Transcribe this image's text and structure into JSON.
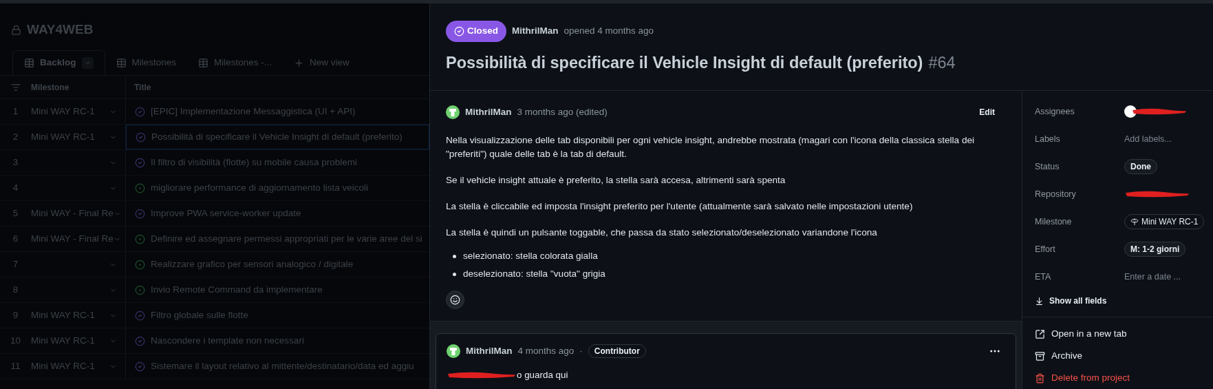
{
  "project": {
    "title": "WAY4WEB"
  },
  "views": [
    {
      "label": "Backlog",
      "selected": true
    },
    {
      "label": "Milestones",
      "selected": false
    },
    {
      "label": "Milestones -...",
      "selected": false
    }
  ],
  "new_view": "New view",
  "table": {
    "columns": [
      "Milestone",
      "Title"
    ],
    "rows": [
      {
        "number": "1",
        "milestone": "Mini WAY RC-1",
        "kind": "closed",
        "title": "[EPIC] Implementazione Messaggistica (UI + API)",
        "selected": false
      },
      {
        "number": "2",
        "milestone": "Mini WAY RC-1",
        "kind": "closed",
        "title": "Possibilità di specificare il Vehicle Insight di default (preferito)",
        "selected": true
      },
      {
        "number": "3",
        "kind": "closed",
        "title": "Il filtro di visibilità (flotte) su mobile causa problemi",
        "selected": false
      },
      {
        "number": "4",
        "kind": "open",
        "title": "migliorare performance di aggiornamento lista veicoli",
        "selected": false
      },
      {
        "number": "5",
        "milestone": "Mini WAY - Final Re",
        "kind": "closed",
        "title": "Improve PWA service-worker update",
        "selected": false
      },
      {
        "number": "6",
        "milestone": "Mini WAY - Final Re",
        "kind": "open",
        "title": "Definire ed assegnare permessi appropriati per le varie aree del si",
        "selected": false
      },
      {
        "number": "7",
        "kind": "open",
        "title": "Realizzare grafico per sensori analogico / digitale",
        "selected": false
      },
      {
        "number": "8",
        "kind": "open",
        "title": "Invio Remote Command da implementare",
        "selected": false
      },
      {
        "number": "9",
        "milestone": "Mini WAY RC-1",
        "kind": "closed",
        "title": "Filtro globale sulle flotte",
        "selected": false
      },
      {
        "number": "10",
        "milestone": "Mini WAY RC-1",
        "kind": "closed",
        "title": "Nascondere i template non necessari",
        "selected": false
      },
      {
        "number": "11",
        "milestone": "Mini WAY RC-1",
        "kind": "closed",
        "title": "Sistemare il layout relativo al mittente/destinatario/data ed aggiu",
        "selected": false
      }
    ]
  },
  "issue": {
    "status": "Closed",
    "author": "MithrilMan",
    "opened": "opened 4 months ago",
    "title": "Possibilità di specificare il Vehicle Insight di default (preferito)",
    "number": "#64"
  },
  "comments": [
    {
      "author": "MithrilMan",
      "time": "3 months ago (edited)",
      "action": "Edit",
      "paragraphs": [
        "Nella visualizzazione delle tab disponibili per ogni vehicle insight, andrebbe mostrata (magari con l'icona della classica stella dei \"preferiti\") quale delle tab è la tab di default.",
        "Se il vehicle insight attuale è preferito, la stella sarà accesa, altrimenti sarà spenta",
        "La stella è cliccabile ed imposta l'insight preferito per l'utente (attualmente sarà salvato nelle impostazioni utente)",
        "La stella è quindi un pulsante toggable, che passa da stato selezionato/deselezionato variandone l'icona"
      ],
      "bullets": [
        "selezionato: stella colorata gialla",
        "deselezionato: stella \"vuota\" grigia"
      ]
    },
    {
      "author": "MithrilMan",
      "time": "4 months ago",
      "separator": "·",
      "role": "Contributor",
      "body": "o guarda qui"
    }
  ],
  "sidebar": {
    "fields": [
      {
        "kind": "avatar",
        "label": "Assignees"
      },
      {
        "kind": "placeholder",
        "label": "Labels",
        "value": "Add labels..."
      },
      {
        "kind": "pill",
        "label": "Status",
        "value": "Done"
      },
      {
        "kind": "redacted",
        "label": "Repository"
      },
      {
        "kind": "milestone",
        "label": "Milestone",
        "value": "Mini WAY RC-1"
      },
      {
        "kind": "pill",
        "label": "Effort",
        "value": "M: 1-2 giorni"
      },
      {
        "kind": "input",
        "label": "ETA",
        "placeholder": "Enter a date ..."
      }
    ],
    "show_all": "Show all fields",
    "actions": [
      {
        "kind": "open",
        "label": "Open in a new tab"
      },
      {
        "kind": "archive",
        "label": "Archive"
      },
      {
        "kind": "delete",
        "label": "Delete from project"
      }
    ]
  }
}
